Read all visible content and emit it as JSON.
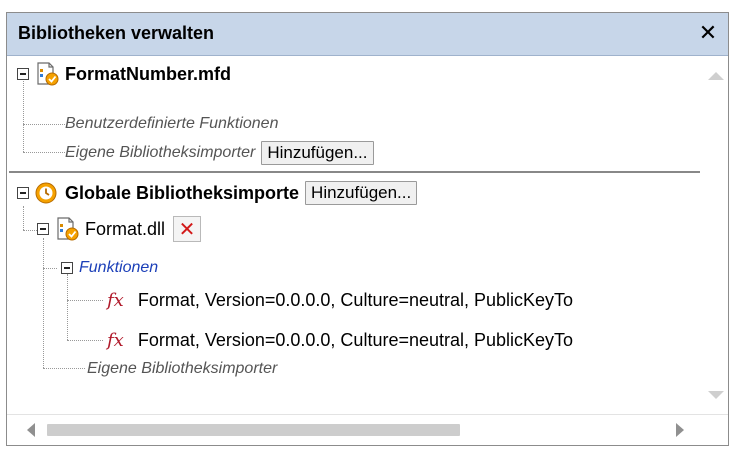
{
  "panel": {
    "title": "Bibliotheken verwalten",
    "close_glyph": "✕"
  },
  "tree": {
    "file_node": {
      "name": "FormatNumber.mfd",
      "user_functions": "Benutzerdefinierte Funktionen",
      "library_imports": "Eigene Bibliotheksimporter",
      "add_button": "Hinzufügen..."
    },
    "global_node": {
      "name": "Globale Bibliotheksimporte",
      "add_button": "Hinzufügen...",
      "library": {
        "name": "Format.dll",
        "delete_glyph": "✕",
        "functions_label": "Funktionen",
        "functions": [
          "Format, Version=0.0.0.0, Culture=neutral, PublicKeyTo",
          "Format, Version=0.0.0.0, Culture=neutral, PublicKeyTo"
        ]
      },
      "library_imports": "Eigene Bibliotheksimporter"
    },
    "fx_glyph": "fx"
  },
  "colors": {
    "titlebar": "#c7d6e9",
    "function_icon": "#b0192a",
    "delete_icon": "#d21919",
    "italic_blue": "#1b3fb8"
  }
}
